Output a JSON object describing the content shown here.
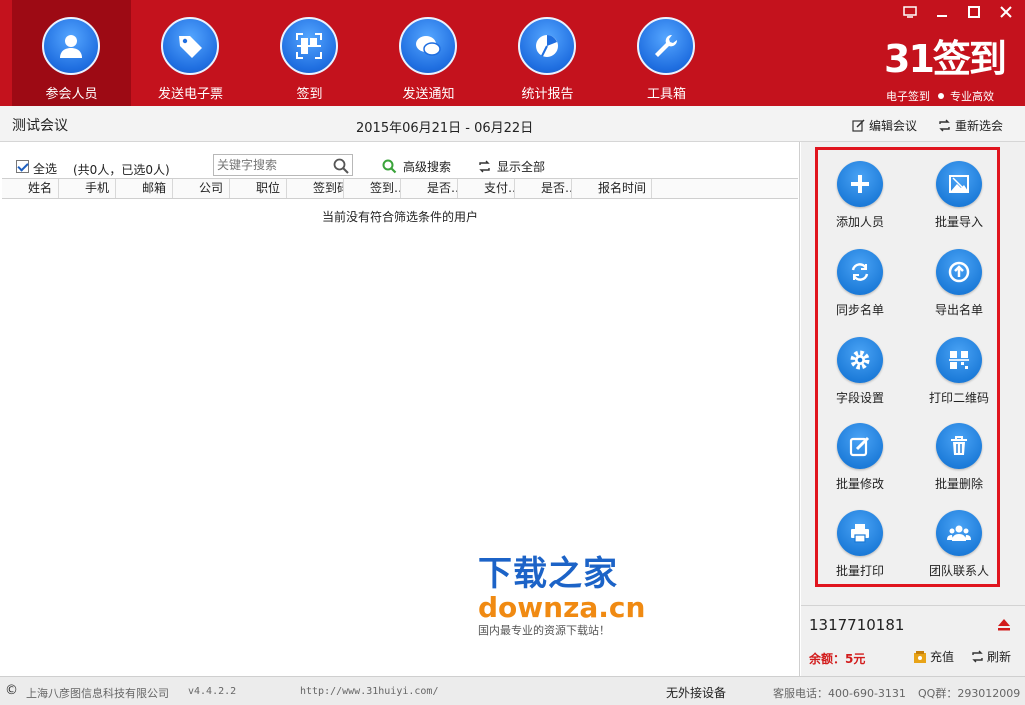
{
  "nav": {
    "items": [
      {
        "label": "参会人员",
        "icon": "person-icon",
        "active": true
      },
      {
        "label": "发送电子票",
        "icon": "ticket-tag-icon",
        "active": false
      },
      {
        "label": "签到",
        "icon": "qr-scan-icon",
        "active": false
      },
      {
        "label": "发送通知",
        "icon": "chat-bubble-icon",
        "active": false
      },
      {
        "label": "统计报告",
        "icon": "pie-chart-icon",
        "active": false
      },
      {
        "label": "工具箱",
        "icon": "wrench-icon",
        "active": false
      }
    ]
  },
  "brand": {
    "logo": "31签到",
    "tagline_left": "电子签到",
    "tagline_right": "专业高效"
  },
  "meeting": {
    "title": "测试会议",
    "date_range": "2015年06月21日 - 06月22日",
    "edit_label": "编辑会议",
    "reselect_label": "重新选会"
  },
  "toolbar": {
    "select_all_label": "全选",
    "count_text": "(共0人，已选0人)",
    "search_placeholder": "关键字搜索",
    "advanced_search_label": "高级搜索",
    "show_all_label": "显示全部"
  },
  "table": {
    "columns": [
      "姓名",
      "手机",
      "邮箱",
      "公司",
      "职位",
      "签到码",
      "签到…",
      "是否…",
      "支付…",
      "是否…",
      "报名时间"
    ],
    "empty_message": "当前没有符合筛选条件的用户"
  },
  "watermark": {
    "cn": "下载之家",
    "en": "downza.cn",
    "tagline": "国内最专业的资源下载站！"
  },
  "actions": [
    {
      "label": "添加人员",
      "icon": "plus-icon"
    },
    {
      "label": "批量导入",
      "icon": "import-image-icon"
    },
    {
      "label": "同步名单",
      "icon": "sync-icon"
    },
    {
      "label": "导出名单",
      "icon": "upload-arrow-icon"
    },
    {
      "label": "字段设置",
      "icon": "gear-icon"
    },
    {
      "label": "打印二维码",
      "icon": "qr-code-icon"
    },
    {
      "label": "批量修改",
      "icon": "edit-icon"
    },
    {
      "label": "批量删除",
      "icon": "trash-icon"
    },
    {
      "label": "批量打印",
      "icon": "printer-icon"
    },
    {
      "label": "团队联系人",
      "icon": "group-icon"
    }
  ],
  "account": {
    "number": "1317710181",
    "balance": "余额：5元",
    "recharge_label": "充值",
    "refresh_label": "刷新"
  },
  "status": {
    "company": "上海八彦图信息科技有限公司",
    "version": "v4.4.2.2",
    "url": "http://www.31huiyi.com/",
    "device": "无外接设备",
    "phone": "客服电话：400-690-3131",
    "qq": "QQ群：293012009"
  },
  "colors": {
    "brand_red": "#c4121d",
    "accent_blue": "#1f6ee0",
    "highlight_border": "#e0141e"
  }
}
